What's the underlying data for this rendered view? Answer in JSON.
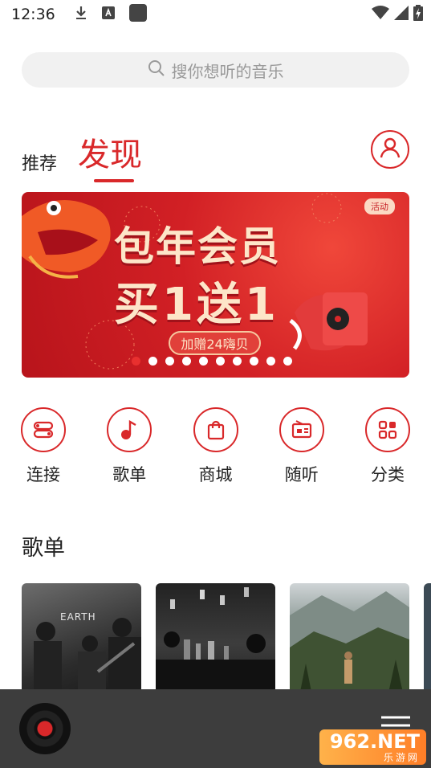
{
  "status_bar": {
    "time": "12:36"
  },
  "search": {
    "placeholder": "搜你想听的音乐"
  },
  "tabs": {
    "recommend": "推荐",
    "discover": "发现"
  },
  "banner": {
    "tag": "活动",
    "line1": "包年会员",
    "line2": "买1送1",
    "pill": "加赠24嗨贝",
    "dot_count": 10,
    "active_dot": 0
  },
  "quick_actions": [
    {
      "label": "连接",
      "icon": "connect-icon"
    },
    {
      "label": "歌单",
      "icon": "music-note-icon"
    },
    {
      "label": "商城",
      "icon": "shopping-bag-icon"
    },
    {
      "label": "随听",
      "icon": "radio-icon"
    },
    {
      "label": "分类",
      "icon": "category-grid-icon"
    }
  ],
  "playlists_section": {
    "title": "歌单",
    "card1_caption": "EARTH"
  },
  "player": {
    "icon": "vinyl-record-icon"
  },
  "watermark": {
    "main": "962.NET",
    "sub": "乐游网"
  },
  "colors": {
    "accent": "#d9282a",
    "player_bg": "#3d3d3d"
  }
}
